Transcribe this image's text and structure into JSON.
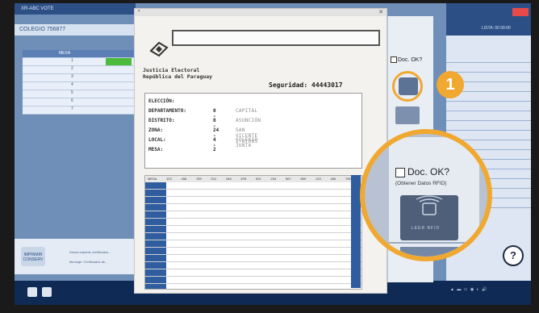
{
  "background_app": {
    "title": "XR-ABC VOTE",
    "header": "COLEGIO 756877",
    "table_header": "MESA",
    "rows": [
      "1",
      "2",
      "3",
      "4",
      "5",
      "6",
      "7"
    ],
    "bottom_button": "IMPRIMIR CONSERV",
    "note1": "Desea imprimir certificados...",
    "note2": "Mensaje: Certificados de..."
  },
  "right_app": {
    "status": "LISTA: 00 00:00"
  },
  "modal": {
    "org_line1": "Justicia Electoral",
    "org_line2": "República del Paraguay",
    "security_label": "Seguridad:",
    "security_code": "44443017",
    "fields": [
      {
        "label": "ELECCIÓN:",
        "code": "",
        "name": ""
      },
      {
        "label": "DEPARTAMENTO:",
        "code": "0 -",
        "name": "CAPITAL"
      },
      {
        "label": "DISTRITO:",
        "code": "0 -",
        "name": "ASUNCIÓN"
      },
      {
        "label": "ZONA:",
        "code": "24 -",
        "name": "SAN VICENTE 2-OTROS"
      },
      {
        "label": "LOCAL:",
        "code": "4 -",
        "name": "COLEGIO JUNTA"
      },
      {
        "label": "MESA:",
        "code": "2",
        "name": ""
      }
    ],
    "tally_header": [
      "MESA",
      "123",
      "456",
      "789",
      "012",
      "345",
      "678",
      "901",
      "234",
      "567",
      "890",
      "123",
      "456",
      "789"
    ],
    "tally_rows": 16
  },
  "side_panel": {
    "doc_ok": "Doc. OK?",
    "step_badge": "1"
  },
  "zoom": {
    "doc_ok": "Doc. OK?",
    "hint": "(Obtener Datos RFID)",
    "button_label": "LEER RFID"
  },
  "colors": {
    "accent": "#f0a830",
    "blue": "#2f5da0"
  }
}
